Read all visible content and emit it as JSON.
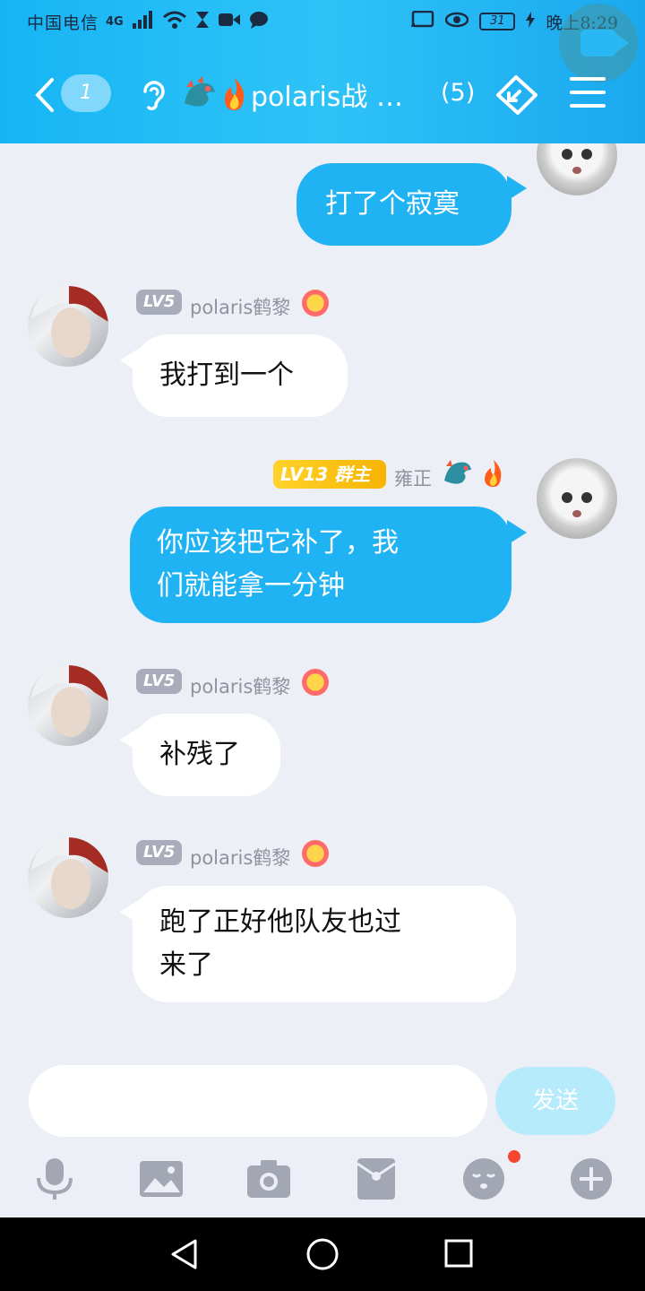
{
  "status_bar": {
    "carrier": "中国电信",
    "network": "4G",
    "battery": "31",
    "time": "晚上8:29"
  },
  "header": {
    "unread_badge": "1",
    "title": "polaris战 …",
    "member_count": "(5)"
  },
  "messages": [
    {
      "side": "out",
      "text": "打了个寂寞"
    },
    {
      "side": "in",
      "level": "LV5",
      "sender": "polaris鹤黎",
      "text": "我打到一个"
    },
    {
      "side": "out",
      "level": "LV13 群主",
      "sender": "雍正",
      "text": "你应该把它补了，我\n们就能拿一分钟"
    },
    {
      "side": "in",
      "level": "LV5",
      "sender": "polaris鹤黎",
      "text": "补残了"
    },
    {
      "side": "in",
      "level": "LV5",
      "sender": "polaris鹤黎",
      "text": "跑了正好他队友也过\n来了"
    }
  ],
  "input": {
    "placeholder": "",
    "send_label": "发送"
  },
  "toolbar_icons": [
    "microphone-icon",
    "image-icon",
    "camera-icon",
    "red-packet-icon",
    "emoji-icon",
    "plus-icon"
  ],
  "colors": {
    "header": "#1fb7f5",
    "outgoing_bubble": "#20b3f4",
    "incoming_bubble": "#ffffff",
    "background": "#eceff5"
  }
}
